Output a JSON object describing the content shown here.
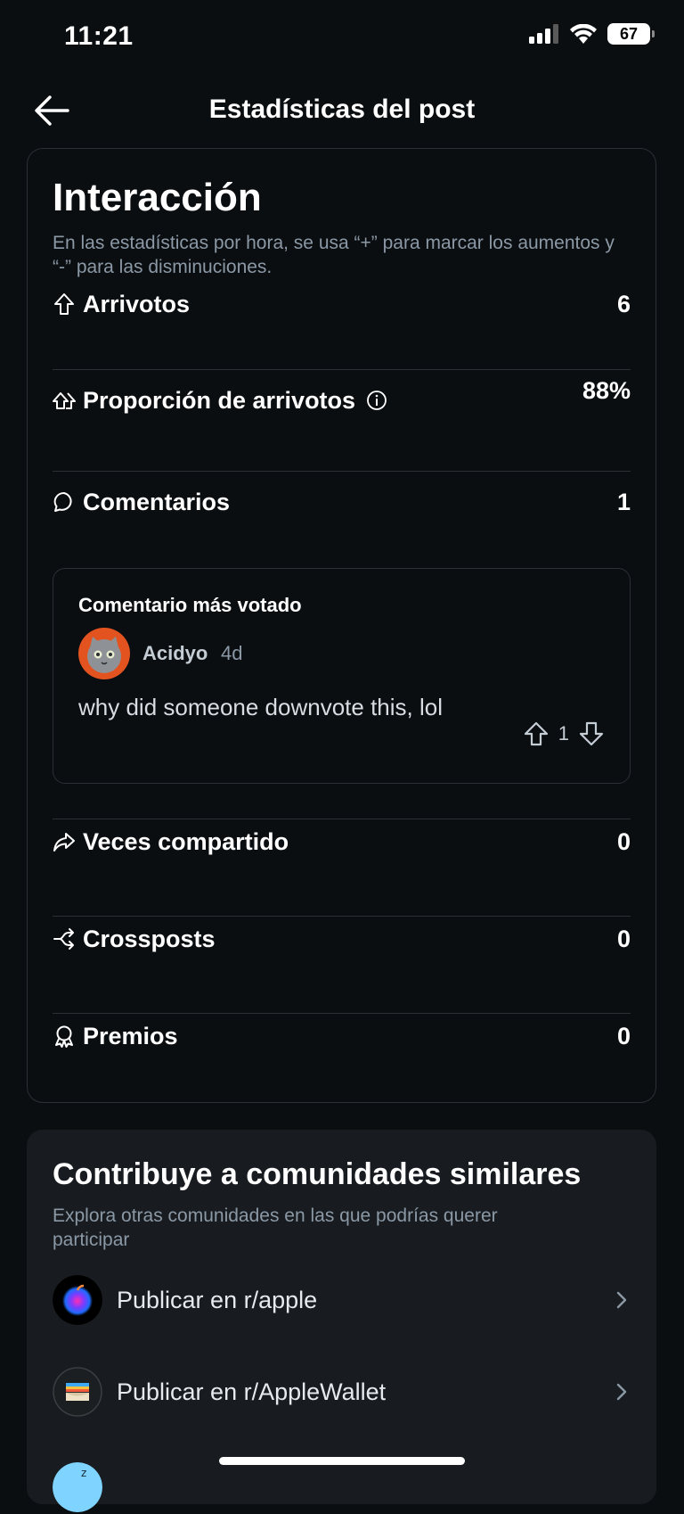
{
  "status_bar": {
    "time": "11:21",
    "battery": "67",
    "icons": [
      "signal-icon",
      "wifi-icon",
      "battery-icon"
    ]
  },
  "nav": {
    "title": "Estadísticas del post",
    "back_icon": "arrow-left-icon"
  },
  "interaction": {
    "heading": "Interacción",
    "subtitle": "En las estadísticas por hora, se usa “+” para marcar los aumentos y “-” para las disminuciones.",
    "stats": [
      {
        "icon": "upvote-icon",
        "label": "Arrivotos",
        "value": "6"
      },
      {
        "icon": "upvote-ratio-icon",
        "label": "Proporción de arrivotos",
        "value": "88%"
      },
      {
        "icon": "comment-icon",
        "label": "Comentarios",
        "value": "1"
      },
      {
        "icon": "share-icon",
        "label": "Veces compartido",
        "value": "0"
      },
      {
        "icon": "crosspost-icon",
        "label": "Crossposts",
        "value": "0"
      },
      {
        "icon": "award-icon",
        "label": "Premios",
        "value": "0"
      }
    ],
    "top_comment": {
      "title": "Comentario más votado",
      "author": "Acidyo",
      "age": "4d",
      "text": "why did someone downvote this, lol",
      "votes": "1"
    }
  },
  "communities": {
    "heading": "Contribuye a comunidades similares",
    "subtitle": "Explora otras comunidades en las que podrías querer participar",
    "items": [
      {
        "label": "Publicar en r/apple"
      },
      {
        "label": "Publicar en r/AppleWallet"
      }
    ]
  },
  "colors": {
    "background": "#0b0e11",
    "card_border": "#2a3036",
    "secondary_text": "#8b98a5",
    "avatar_accent": "#e3531f"
  }
}
